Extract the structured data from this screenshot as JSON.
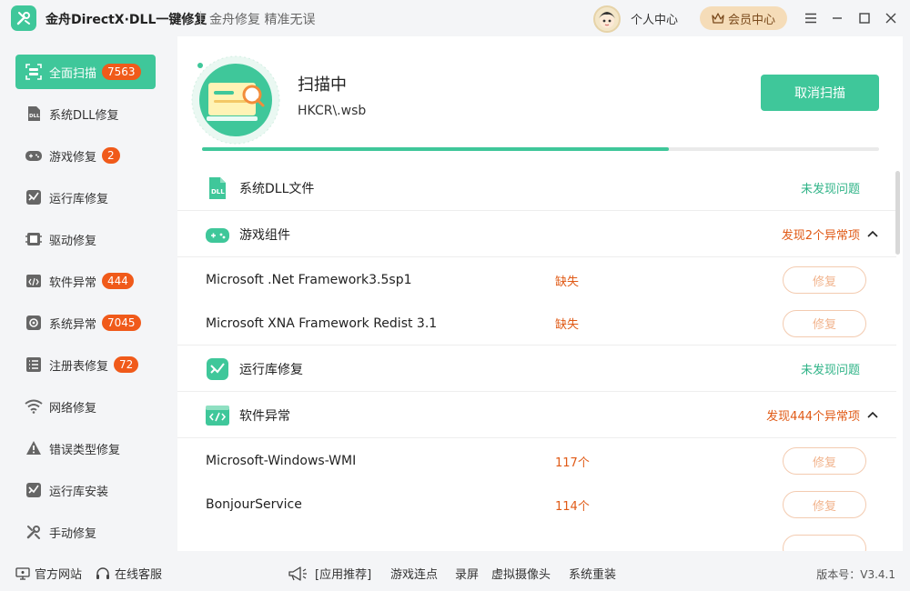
{
  "app": {
    "title": "金舟DirectX·DLL一键修复",
    "slogan": "金舟修复 精准无误",
    "profile_label": "个人中心",
    "vip_label": "会员中心"
  },
  "sidebar": {
    "items": [
      {
        "label": "全面扫描",
        "badge": "7563",
        "icon": "scan-icon",
        "active": true
      },
      {
        "label": "系统DLL修复",
        "badge": "",
        "icon": "dll-icon"
      },
      {
        "label": "游戏修复",
        "badge": "2",
        "icon": "gamepad-icon"
      },
      {
        "label": "运行库修复",
        "badge": "",
        "icon": "runtime-icon"
      },
      {
        "label": "驱动修复",
        "badge": "",
        "icon": "driver-icon"
      },
      {
        "label": "软件异常",
        "badge": "444",
        "icon": "code-icon"
      },
      {
        "label": "系统异常",
        "badge": "7045",
        "icon": "gear-icon"
      },
      {
        "label": "注册表修复",
        "badge": "72",
        "icon": "list-icon"
      },
      {
        "label": "网络修复",
        "badge": "",
        "icon": "wifi-icon"
      },
      {
        "label": "错误类型修复",
        "badge": "",
        "icon": "warning-icon"
      },
      {
        "label": "运行库安装",
        "badge": "",
        "icon": "install-icon"
      },
      {
        "label": "手动修复",
        "badge": "",
        "icon": "wrench-icon"
      }
    ]
  },
  "scan": {
    "title": "扫描中",
    "path": "HKCR\\.wsb",
    "cancel_label": "取消扫描",
    "progress": 0.69
  },
  "categories": {
    "dll": {
      "label": "系统DLL文件",
      "status": "未发现问题"
    },
    "game": {
      "label": "游戏组件",
      "status": "发现2个异常项"
    },
    "runtime": {
      "label": "运行库修复",
      "status": "未发现问题"
    },
    "software": {
      "label": "软件异常",
      "status": "发现444个异常项"
    }
  },
  "game_items": [
    {
      "name": "Microsoft .Net Framework3.5sp1",
      "detail": "缺失",
      "action": "修复"
    },
    {
      "name": "Microsoft XNA Framework Redist 3.1",
      "detail": "缺失",
      "action": "修复"
    }
  ],
  "software_items": [
    {
      "name": "Microsoft-Windows-WMI",
      "detail": "117个",
      "action": "修复"
    },
    {
      "name": "BonjourService",
      "detail": "114个",
      "action": "修复"
    }
  ],
  "footer": {
    "official_site": "官方网站",
    "online_service": "在线客服",
    "recommend": "[应用推荐]",
    "links": [
      "游戏连点",
      "录屏",
      "虚拟摄像头",
      "系统重装"
    ],
    "version": "版本号：V3.4.1"
  },
  "colors": {
    "accent": "#3fc79a",
    "warning": "#e05a16",
    "badge": "#f05a1a"
  }
}
